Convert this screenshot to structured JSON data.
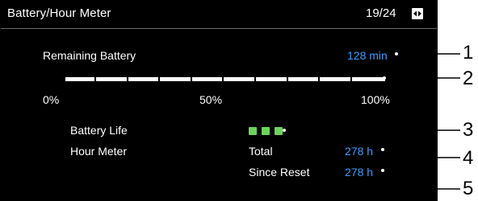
{
  "header": {
    "title": "Battery/Hour Meter",
    "page": "19/24",
    "page_icon": "page-nav-icon"
  },
  "battery": {
    "label": "Remaining Battery",
    "value": "128 min"
  },
  "bar": {
    "fill_percent": 100,
    "labels": {
      "start": "0%",
      "mid": "50%",
      "end": "100%"
    }
  },
  "battery_life": {
    "label": "Battery Life",
    "level": 3,
    "segments": 3,
    "color": "#6cd35b"
  },
  "hour_meter": {
    "label": "Hour Meter",
    "total_label": "Total",
    "total_value": "278 h",
    "since_label": "Since Reset",
    "since_value": "278 h"
  },
  "colors": {
    "value_blue": "#3a9cff",
    "background": "#000000"
  },
  "callouts": [
    "1",
    "2",
    "3",
    "4",
    "5"
  ]
}
